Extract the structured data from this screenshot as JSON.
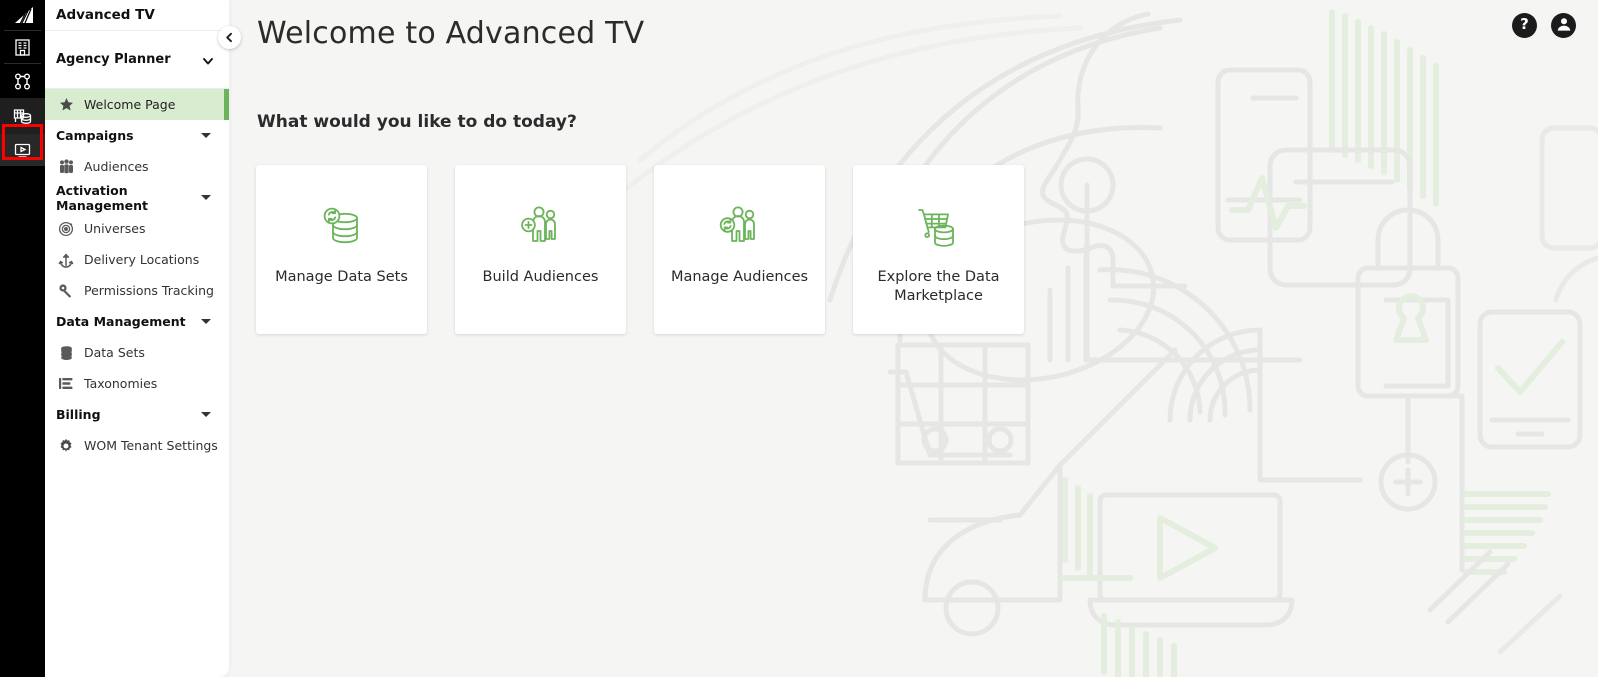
{
  "theme": {
    "accent_green": "#6cb45b",
    "active_nav_bg": "#d8edcf",
    "rail_bg": "#000000",
    "page_bg": "#f5f5f4",
    "annotation_red": "#ff0000",
    "text_dark": "#2b2b2b"
  },
  "rail": {
    "items": [
      {
        "name": "app-logo",
        "icon": "fan-logo-icon",
        "active": false
      },
      {
        "name": "rail-item-buildings",
        "icon": "building-icon",
        "active": false
      },
      {
        "name": "rail-item-network",
        "icon": "network-nodes-icon",
        "active": false
      },
      {
        "name": "rail-item-data-platform",
        "icon": "data-grid-database-icon",
        "active": true
      },
      {
        "name": "rail-item-video",
        "icon": "video-player-icon",
        "active": false
      }
    ]
  },
  "sidebar": {
    "brand": "Advanced TV",
    "selector": {
      "label": "Agency Planner",
      "icon": "chevron-down-icon"
    },
    "collapse_button": {
      "icon": "chevron-left-icon"
    },
    "nav": [
      {
        "type": "item",
        "label": "Welcome Page",
        "icon": "star-icon",
        "active": true,
        "key": "welcome-page"
      },
      {
        "type": "group",
        "label": "Campaigns",
        "icon": "caret-down-icon",
        "key": "campaigns"
      },
      {
        "type": "item",
        "label": "Audiences",
        "icon": "people-group-icon",
        "active": false,
        "key": "audiences"
      },
      {
        "type": "group",
        "label": "Activation Management",
        "icon": "caret-down-icon",
        "key": "activation-management"
      },
      {
        "type": "item",
        "label": "Universes",
        "icon": "orbit-target-icon",
        "active": false,
        "key": "universes"
      },
      {
        "type": "item",
        "label": "Delivery Locations",
        "icon": "anchor-arrows-icon",
        "active": false,
        "key": "delivery-locations"
      },
      {
        "type": "item",
        "label": "Permissions Tracking",
        "icon": "key-icon",
        "active": false,
        "key": "permissions-tracking"
      },
      {
        "type": "group",
        "label": "Data Management",
        "icon": "caret-down-icon",
        "key": "data-management"
      },
      {
        "type": "item",
        "label": "Data Sets",
        "icon": "database-stack-icon",
        "active": false,
        "key": "data-sets"
      },
      {
        "type": "item",
        "label": "Taxonomies",
        "icon": "taxonomy-list-icon",
        "active": false,
        "key": "taxonomies"
      },
      {
        "type": "group",
        "label": "Billing",
        "icon": "caret-down-icon",
        "key": "billing"
      },
      {
        "type": "item",
        "label": "WOM Tenant Settings",
        "icon": "gear-icon",
        "active": false,
        "key": "wom-tenant-settings"
      }
    ]
  },
  "header": {
    "actions": [
      {
        "name": "help-button",
        "icon": "question-mark-icon",
        "label": "?"
      },
      {
        "name": "account-button",
        "icon": "user-avatar-icon",
        "label": ""
      }
    ]
  },
  "main": {
    "title": "Welcome to Advanced TV",
    "section_question": "What would you like to do today?",
    "cards": [
      {
        "label": "Manage Data Sets",
        "icon": "database-refresh-icon",
        "key": "manage-data-sets"
      },
      {
        "label": "Build Audiences",
        "icon": "person-add-icon",
        "key": "build-audiences"
      },
      {
        "label": "Manage Audiences",
        "icon": "person-refresh-icon",
        "key": "manage-audiences"
      },
      {
        "label": "Explore the Data Marketplace",
        "icon": "cart-database-icon",
        "key": "explore-data-marketplace"
      }
    ]
  },
  "annotation": {
    "highlight_target": "rail-item-data-platform",
    "color": "#ff0000"
  }
}
